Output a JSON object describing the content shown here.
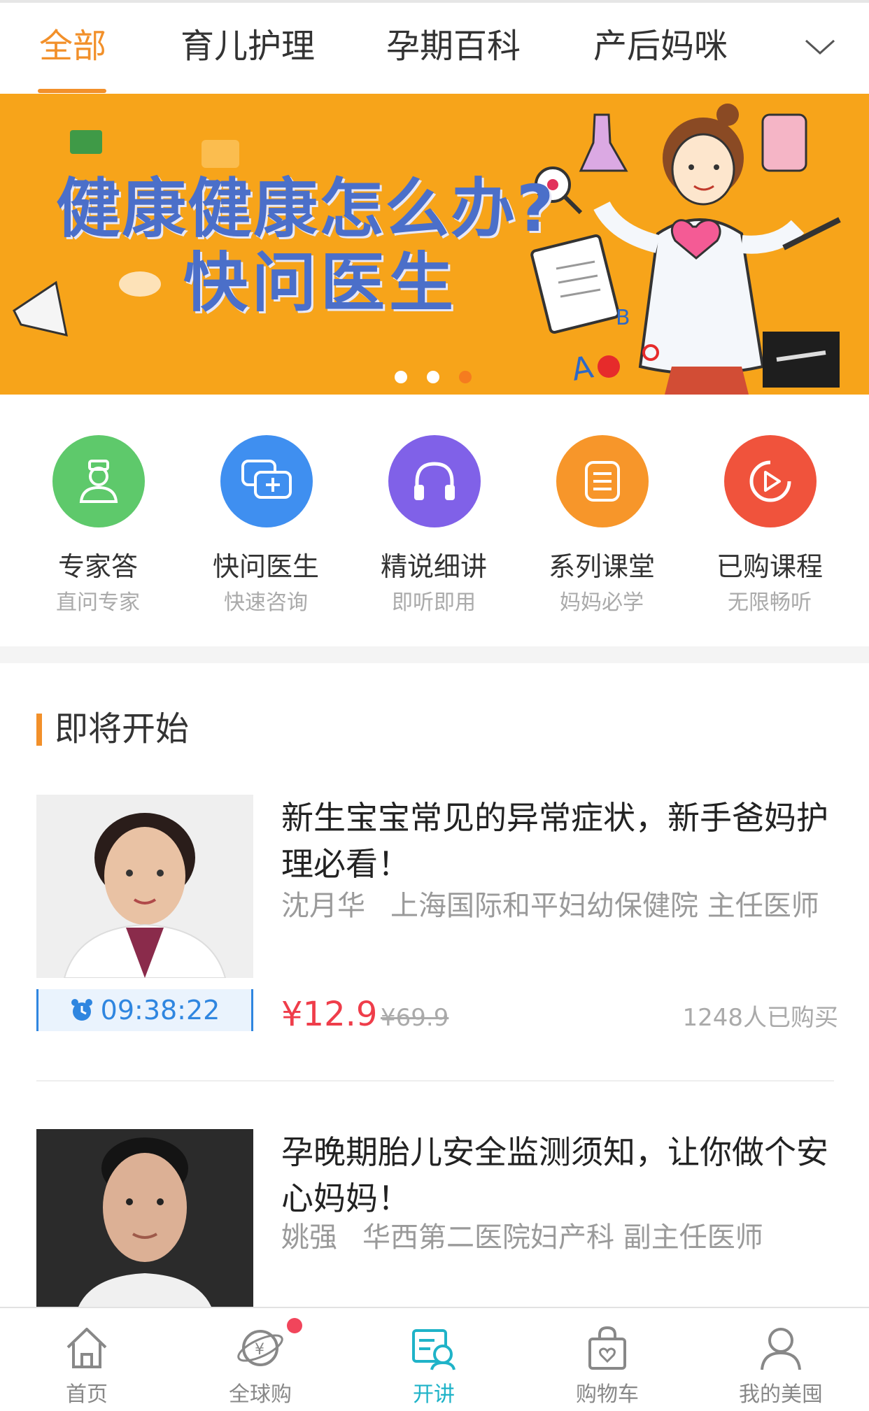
{
  "tabs": {
    "items": [
      {
        "label": "全部",
        "active": true
      },
      {
        "label": "育儿护理",
        "active": false
      },
      {
        "label": "孕期百科",
        "active": false
      },
      {
        "label": "产后妈咪",
        "active": false
      }
    ],
    "more_icon": "chevron-down-icon"
  },
  "banner": {
    "line1": "健康健康怎么办?",
    "line2": "快问医生",
    "background_color": "#f7a41a",
    "text_color": "#4b6fc9",
    "slide_count": 3,
    "active_slide": 3
  },
  "quick_links": [
    {
      "title": "专家答",
      "subtitle": "直问专家",
      "icon": "doctor-icon",
      "color": "#5ec96b"
    },
    {
      "title": "快问医生",
      "subtitle": "快速咨询",
      "icon": "chat-plus-icon",
      "color": "#3f8ff0"
    },
    {
      "title": "精说细讲",
      "subtitle": "即听即用",
      "icon": "headphones-icon",
      "color": "#8061e8"
    },
    {
      "title": "系列课堂",
      "subtitle": "妈妈必学",
      "icon": "list-icon",
      "color": "#f7962a"
    },
    {
      "title": "已购课程",
      "subtitle": "无限畅听",
      "icon": "play-icon",
      "color": "#f0533c"
    }
  ],
  "section": {
    "title": "即将开始"
  },
  "courses": [
    {
      "title": "新生宝宝常见的异常症状，新手爸妈护理必看！",
      "doctor": "沈月华",
      "hospital": "上海国际和平妇幼保健院 主任医师",
      "countdown": "09:38:22",
      "price": "¥12.9",
      "original_price": "¥69.9",
      "sold": "1248人已购买"
    },
    {
      "title": "孕晚期胎儿安全监测须知，让你做个安心妈妈！",
      "doctor": "姚强",
      "hospital": "华西第二医院妇产科 副主任医师"
    }
  ],
  "bottom_nav": [
    {
      "label": "首页",
      "icon": "home-icon",
      "active": false
    },
    {
      "label": "全球购",
      "icon": "global-shop-icon",
      "active": false,
      "badge": true
    },
    {
      "label": "开讲",
      "icon": "lecture-icon",
      "active": true
    },
    {
      "label": "购物车",
      "icon": "shopping-bag-icon",
      "active": false
    },
    {
      "label": "我的美囤",
      "icon": "profile-icon",
      "active": false
    }
  ],
  "colors": {
    "accent": "#f2902a",
    "price": "#ef3d4a",
    "countdown": "#2f86e0",
    "nav_active": "#1fb3c8"
  }
}
